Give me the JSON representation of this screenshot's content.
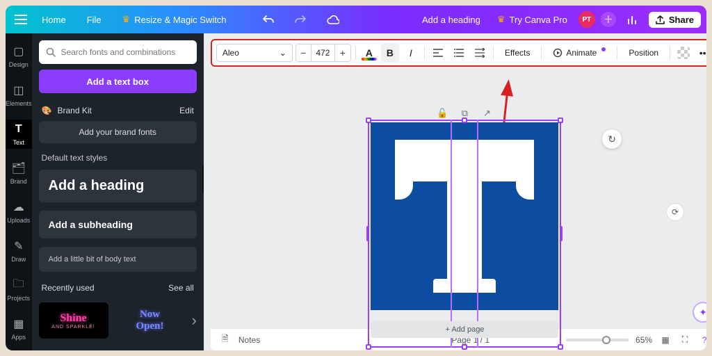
{
  "topbar": {
    "home": "Home",
    "file": "File",
    "resize": "Resize & Magic Switch",
    "add_heading": "Add a heading",
    "try_pro": "Try Canva Pro",
    "avatar": "PT",
    "share": "Share"
  },
  "rail": {
    "items": [
      {
        "label": "Design"
      },
      {
        "label": "Elements"
      },
      {
        "label": "Text"
      },
      {
        "label": "Brand"
      },
      {
        "label": "Uploads"
      },
      {
        "label": "Draw"
      },
      {
        "label": "Projects"
      },
      {
        "label": "Apps"
      }
    ]
  },
  "panel": {
    "search_placeholder": "Search fonts and combinations",
    "add_text_box": "Add a text box",
    "brand_kit": "Brand Kit",
    "brand_kit_edit": "Edit",
    "brand_fonts": "Add your brand fonts",
    "default_styles": "Default text styles",
    "heading": "Add a heading",
    "subheading": "Add a subheading",
    "body": "Add a little bit of body text",
    "recent": "Recently used",
    "see_all": "See all",
    "thumb1a": "Shine",
    "thumb1b": "AND SPARKLE!",
    "thumb2a": "Now",
    "thumb2b": "Open!"
  },
  "toolbar": {
    "font": "Aleo",
    "size": "472",
    "effects": "Effects",
    "animate": "Animate",
    "position": "Position"
  },
  "canvas": {
    "add_page": "+ Add page"
  },
  "bottom": {
    "notes": "Notes",
    "page": "Page 1 / 1",
    "zoom": "65%"
  }
}
